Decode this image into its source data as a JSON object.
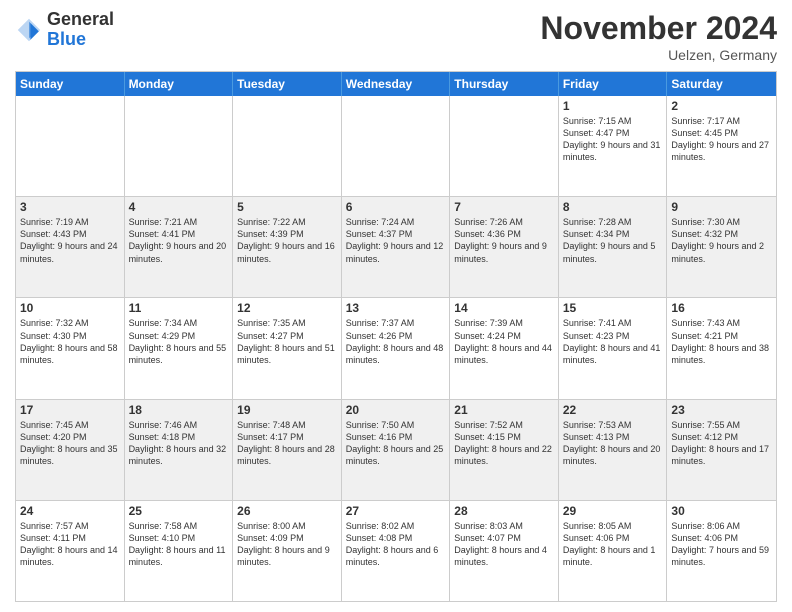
{
  "header": {
    "logo_general": "General",
    "logo_blue": "Blue",
    "month_title": "November 2024",
    "location": "Uelzen, Germany"
  },
  "calendar": {
    "days_of_week": [
      "Sunday",
      "Monday",
      "Tuesday",
      "Wednesday",
      "Thursday",
      "Friday",
      "Saturday"
    ],
    "rows": [
      [
        {
          "day": "",
          "info": ""
        },
        {
          "day": "",
          "info": ""
        },
        {
          "day": "",
          "info": ""
        },
        {
          "day": "",
          "info": ""
        },
        {
          "day": "",
          "info": ""
        },
        {
          "day": "1",
          "info": "Sunrise: 7:15 AM\nSunset: 4:47 PM\nDaylight: 9 hours and 31 minutes."
        },
        {
          "day": "2",
          "info": "Sunrise: 7:17 AM\nSunset: 4:45 PM\nDaylight: 9 hours and 27 minutes."
        }
      ],
      [
        {
          "day": "3",
          "info": "Sunrise: 7:19 AM\nSunset: 4:43 PM\nDaylight: 9 hours and 24 minutes."
        },
        {
          "day": "4",
          "info": "Sunrise: 7:21 AM\nSunset: 4:41 PM\nDaylight: 9 hours and 20 minutes."
        },
        {
          "day": "5",
          "info": "Sunrise: 7:22 AM\nSunset: 4:39 PM\nDaylight: 9 hours and 16 minutes."
        },
        {
          "day": "6",
          "info": "Sunrise: 7:24 AM\nSunset: 4:37 PM\nDaylight: 9 hours and 12 minutes."
        },
        {
          "day": "7",
          "info": "Sunrise: 7:26 AM\nSunset: 4:36 PM\nDaylight: 9 hours and 9 minutes."
        },
        {
          "day": "8",
          "info": "Sunrise: 7:28 AM\nSunset: 4:34 PM\nDaylight: 9 hours and 5 minutes."
        },
        {
          "day": "9",
          "info": "Sunrise: 7:30 AM\nSunset: 4:32 PM\nDaylight: 9 hours and 2 minutes."
        }
      ],
      [
        {
          "day": "10",
          "info": "Sunrise: 7:32 AM\nSunset: 4:30 PM\nDaylight: 8 hours and 58 minutes."
        },
        {
          "day": "11",
          "info": "Sunrise: 7:34 AM\nSunset: 4:29 PM\nDaylight: 8 hours and 55 minutes."
        },
        {
          "day": "12",
          "info": "Sunrise: 7:35 AM\nSunset: 4:27 PM\nDaylight: 8 hours and 51 minutes."
        },
        {
          "day": "13",
          "info": "Sunrise: 7:37 AM\nSunset: 4:26 PM\nDaylight: 8 hours and 48 minutes."
        },
        {
          "day": "14",
          "info": "Sunrise: 7:39 AM\nSunset: 4:24 PM\nDaylight: 8 hours and 44 minutes."
        },
        {
          "day": "15",
          "info": "Sunrise: 7:41 AM\nSunset: 4:23 PM\nDaylight: 8 hours and 41 minutes."
        },
        {
          "day": "16",
          "info": "Sunrise: 7:43 AM\nSunset: 4:21 PM\nDaylight: 8 hours and 38 minutes."
        }
      ],
      [
        {
          "day": "17",
          "info": "Sunrise: 7:45 AM\nSunset: 4:20 PM\nDaylight: 8 hours and 35 minutes."
        },
        {
          "day": "18",
          "info": "Sunrise: 7:46 AM\nSunset: 4:18 PM\nDaylight: 8 hours and 32 minutes."
        },
        {
          "day": "19",
          "info": "Sunrise: 7:48 AM\nSunset: 4:17 PM\nDaylight: 8 hours and 28 minutes."
        },
        {
          "day": "20",
          "info": "Sunrise: 7:50 AM\nSunset: 4:16 PM\nDaylight: 8 hours and 25 minutes."
        },
        {
          "day": "21",
          "info": "Sunrise: 7:52 AM\nSunset: 4:15 PM\nDaylight: 8 hours and 22 minutes."
        },
        {
          "day": "22",
          "info": "Sunrise: 7:53 AM\nSunset: 4:13 PM\nDaylight: 8 hours and 20 minutes."
        },
        {
          "day": "23",
          "info": "Sunrise: 7:55 AM\nSunset: 4:12 PM\nDaylight: 8 hours and 17 minutes."
        }
      ],
      [
        {
          "day": "24",
          "info": "Sunrise: 7:57 AM\nSunset: 4:11 PM\nDaylight: 8 hours and 14 minutes."
        },
        {
          "day": "25",
          "info": "Sunrise: 7:58 AM\nSunset: 4:10 PM\nDaylight: 8 hours and 11 minutes."
        },
        {
          "day": "26",
          "info": "Sunrise: 8:00 AM\nSunset: 4:09 PM\nDaylight: 8 hours and 9 minutes."
        },
        {
          "day": "27",
          "info": "Sunrise: 8:02 AM\nSunset: 4:08 PM\nDaylight: 8 hours and 6 minutes."
        },
        {
          "day": "28",
          "info": "Sunrise: 8:03 AM\nSunset: 4:07 PM\nDaylight: 8 hours and 4 minutes."
        },
        {
          "day": "29",
          "info": "Sunrise: 8:05 AM\nSunset: 4:06 PM\nDaylight: 8 hours and 1 minute."
        },
        {
          "day": "30",
          "info": "Sunrise: 8:06 AM\nSunset: 4:06 PM\nDaylight: 7 hours and 59 minutes."
        }
      ]
    ]
  }
}
